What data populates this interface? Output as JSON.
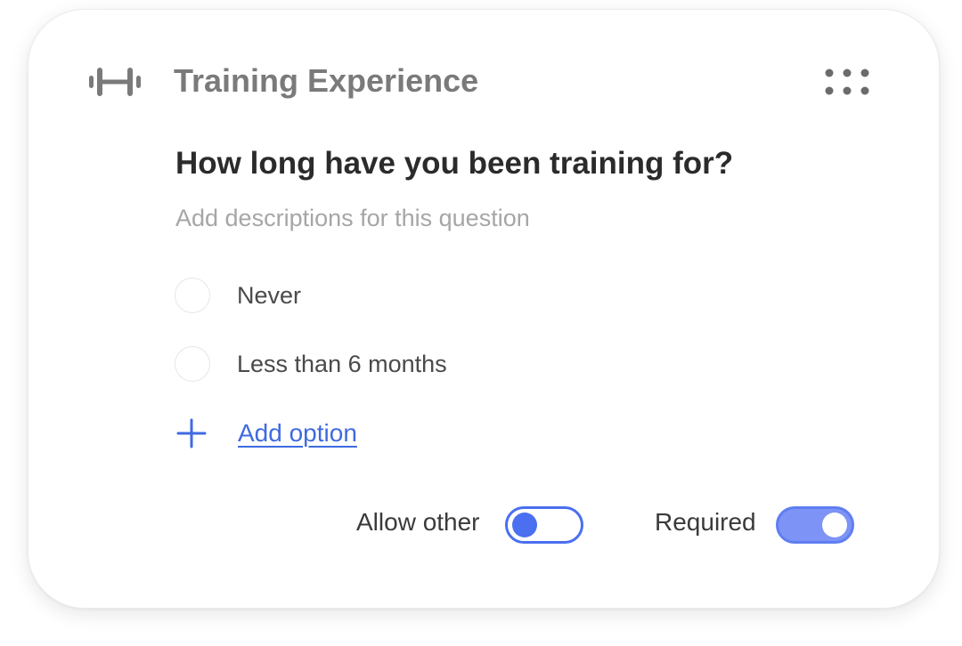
{
  "section": {
    "icon": "dumbbell-icon",
    "title": "Training Experience",
    "menu_icon": "grip-dots-icon"
  },
  "question": {
    "text": "How long have you been training for?",
    "description_placeholder": "Add descriptions for this question"
  },
  "options": [
    {
      "label": "Never",
      "selected": false
    },
    {
      "label": "Less than 6 months",
      "selected": false
    }
  ],
  "add_option": {
    "icon": "plus-icon",
    "label": "Add option"
  },
  "settings": {
    "allow_other": {
      "label": "Allow other",
      "enabled": false
    },
    "required": {
      "label": "Required",
      "enabled": true
    }
  },
  "colors": {
    "accent": "#4a6ff0",
    "toggle_on_fill": "#7d93f5",
    "link": "#3f6ae0",
    "title_gray": "#7a7a7a",
    "question_text": "#2b2b2b",
    "placeholder_gray": "#a6a6a6"
  }
}
